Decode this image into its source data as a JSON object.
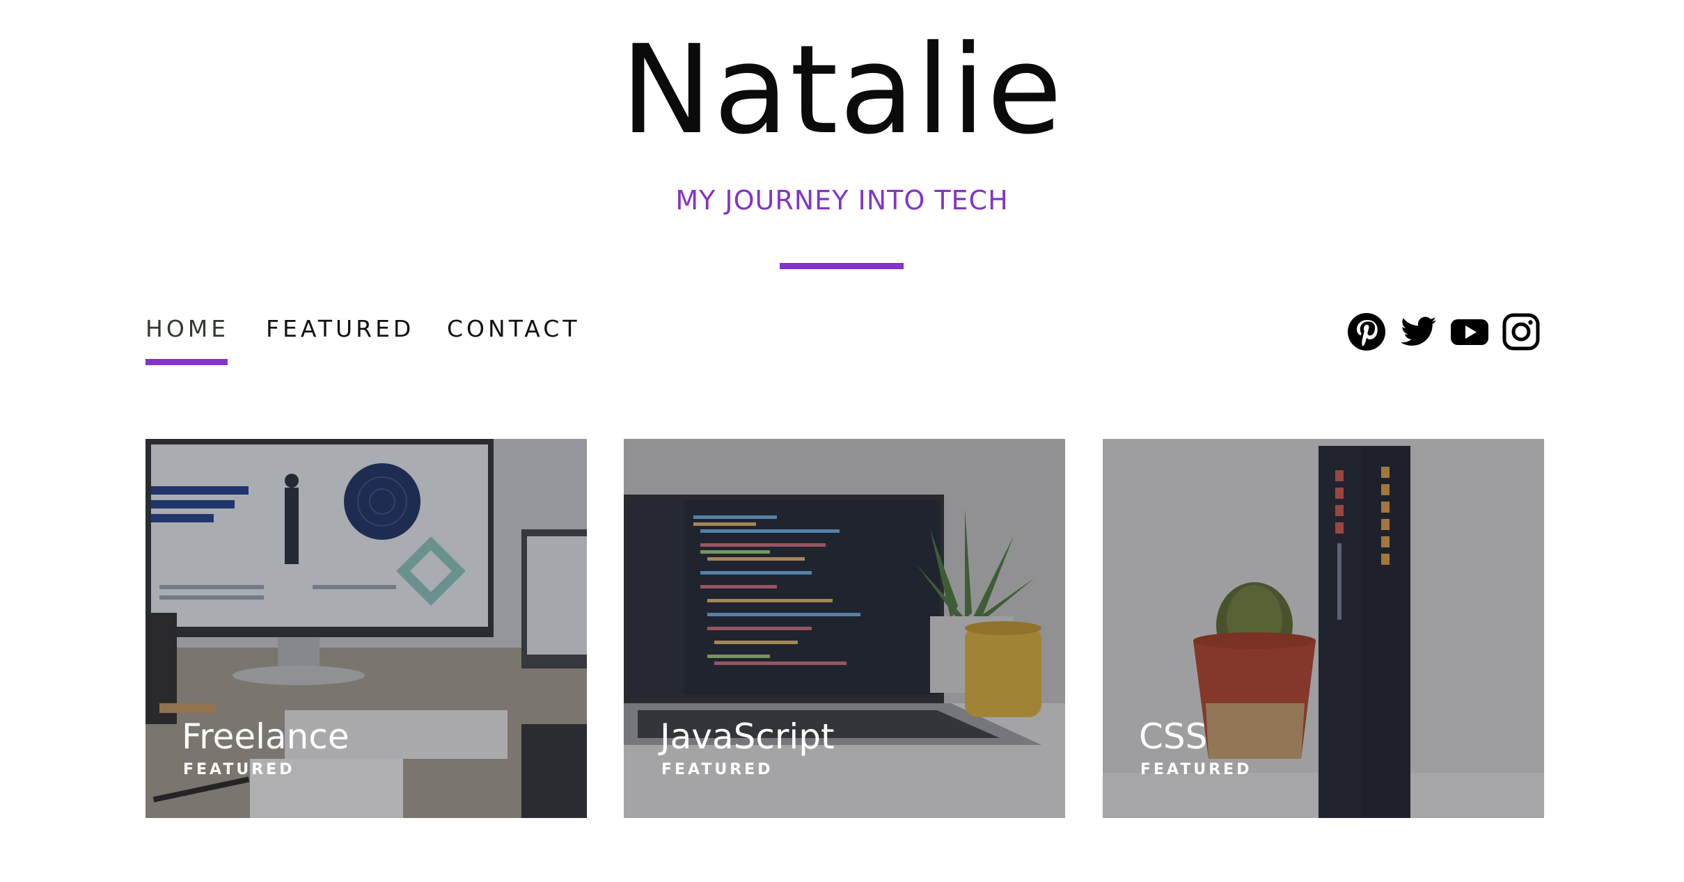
{
  "site": {
    "title": "Natalie",
    "tagline": "MY JOURNEY INTO TECH",
    "accent_color": "#8235c8"
  },
  "nav": {
    "items": [
      {
        "label": "HOME",
        "active": true
      },
      {
        "label": "FEATURED",
        "active": false
      },
      {
        "label": "CONTACT",
        "active": false
      }
    ]
  },
  "social": {
    "icons": [
      "pinterest-icon",
      "twitter-icon",
      "youtube-icon",
      "instagram-icon"
    ]
  },
  "posts": [
    {
      "title": "Freelance",
      "category": "FEATURED",
      "image": "desk-monitor-laptop-photo"
    },
    {
      "title": "JavaScript",
      "category": "FEATURED",
      "image": "laptop-code-plant-photo"
    },
    {
      "title": "CSS",
      "category": "FEATURED",
      "image": "cactus-books-photo"
    }
  ]
}
